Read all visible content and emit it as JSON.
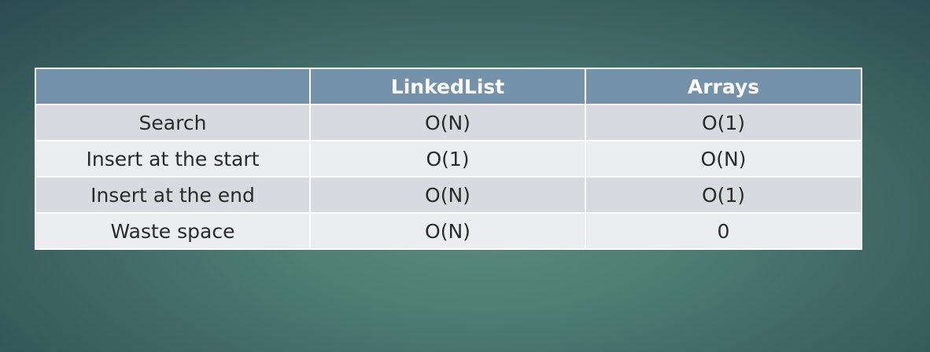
{
  "table": {
    "header": {
      "corner": "",
      "col1": "LinkedList",
      "col2": "Arrays"
    },
    "rows": [
      {
        "label": "Search",
        "linkedlist": "O(N)",
        "arrays": "O(1)"
      },
      {
        "label": "Insert at the start",
        "linkedlist": "O(1)",
        "arrays": "O(N)"
      },
      {
        "label": "Insert at the end",
        "linkedlist": "O(N)",
        "arrays": "O(1)"
      },
      {
        "label": "Waste space",
        "linkedlist": "O(N)",
        "arrays": "0"
      }
    ]
  },
  "colors": {
    "header_bg": "#7492aa",
    "row_odd_bg": "#d7dbe0",
    "row_even_bg": "#ecedf0",
    "border": "#ffffff"
  }
}
